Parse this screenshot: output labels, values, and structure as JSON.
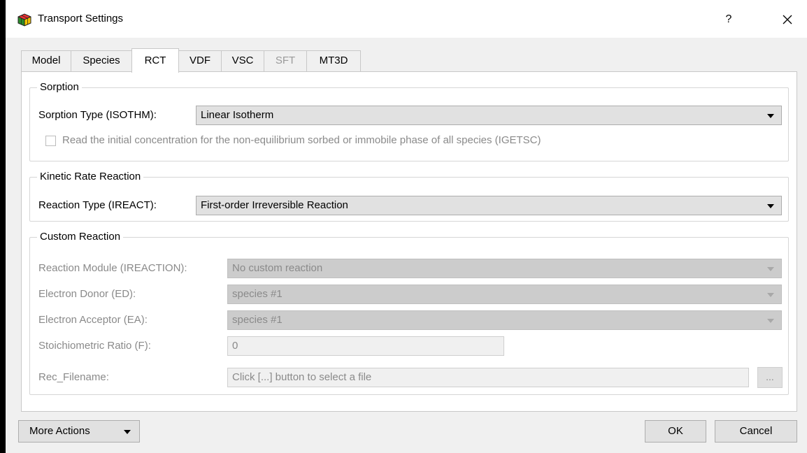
{
  "window": {
    "title": "Transport Settings",
    "help_label": "?",
    "close_label": "✕"
  },
  "tabs": [
    {
      "label": "Model",
      "state": "normal"
    },
    {
      "label": "Species",
      "state": "normal"
    },
    {
      "label": "RCT",
      "state": "active"
    },
    {
      "label": "VDF",
      "state": "normal"
    },
    {
      "label": "VSC",
      "state": "normal"
    },
    {
      "label": "SFT",
      "state": "disabled"
    },
    {
      "label": "MT3D",
      "state": "normal"
    }
  ],
  "sorption": {
    "group_title": "Sorption",
    "type_label": "Sorption Type (ISOTHM):",
    "type_value": "Linear Isotherm",
    "checkbox_label": "Read the initial concentration for the non-equilibrium sorbed or immobile phase of all species (IGETSC)",
    "checkbox_checked": false
  },
  "kinetic": {
    "group_title": "Kinetic Rate Reaction",
    "type_label": "Reaction Type (IREACT):",
    "type_value": "First-order Irreversible Reaction"
  },
  "custom": {
    "group_title": "Custom Reaction",
    "module_label": "Reaction Module (IREACTION):",
    "module_value": "No custom reaction",
    "donor_label": "Electron Donor (ED):",
    "donor_value": "species #1",
    "acceptor_label": "Electron Acceptor (EA):",
    "acceptor_value": "species #1",
    "ratio_label": "Stoichiometric Ratio (F):",
    "ratio_value": "0",
    "filename_label": "Rec_Filename:",
    "filename_placeholder": "Click [...] button to select a file",
    "browse_label": "..."
  },
  "footer": {
    "more_actions_label": "More Actions",
    "ok_label": "OK",
    "cancel_label": "Cancel"
  }
}
